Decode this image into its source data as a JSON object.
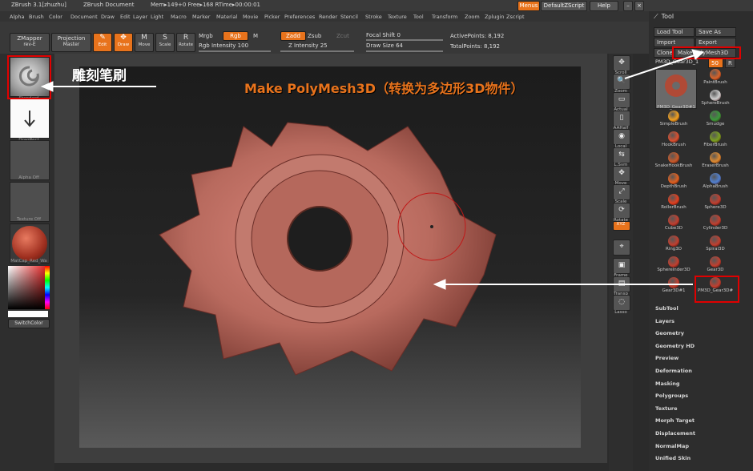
{
  "titlebar": {
    "app": "ZBrush  3.1[zhuzhu]",
    "document": "ZBrush Document",
    "stats": "Mem▸149+0  Free▸168  RTime▸00:00:01",
    "menus_btn": "Menus",
    "script_btn": "DefaultZScript",
    "help_btn": "Help"
  },
  "menubar": {
    "items": [
      "Alpha",
      "Brush",
      "Color",
      "Document",
      "Draw",
      "Edit",
      "Layer",
      "Light",
      "Macro",
      "Marker",
      "Material",
      "Movie",
      "Picker",
      "Preferences",
      "Render",
      "Stencil",
      "Stroke",
      "Texture",
      "Tool",
      "Transform",
      "Zoom",
      "Zplugin",
      "Zscript"
    ]
  },
  "toolbar": {
    "zmapper": "ZMapper",
    "zmapper_sub": "rev-E",
    "projection": "Projection",
    "projection_sub": "Master",
    "edit": "Edit",
    "draw": "Draw",
    "move": "Move",
    "scale": "Scale",
    "rotate": "Rotate",
    "mrgb": "Mrgb",
    "rgb": "Rgb",
    "m": "M",
    "rgb_intensity": "Rgb Intensity 100",
    "zadd": "Zadd",
    "zsub": "Zsub",
    "zcut": "Zcut",
    "z_intensity": "Z Intensity 25",
    "focal_shift": "Focal Shift 0",
    "draw_size": "Draw Size 64",
    "active_points": "ActivePoints: 8,192",
    "total_points": "TotalPoints: 8,192"
  },
  "leftshelf": {
    "brush_label": "Standard",
    "stroke_label": "DragRect",
    "alpha_label": "Alpha  Off",
    "texture_label": "Texture  Off",
    "material_label": "MatCap_Red_Wa",
    "switch_color": "SwitchColor"
  },
  "rightshelf": {
    "items": [
      "Scroll",
      "Zoom",
      "Actual",
      "AAHalf",
      "Local",
      "L.Sym",
      "Move",
      "Scale",
      "Rotate",
      "XYZ",
      "",
      "Frame",
      "Transp",
      "Lasso"
    ]
  },
  "toolpanel": {
    "title": "Tool",
    "load_tool": "Load Tool",
    "save_as": "Save As",
    "import": "Import",
    "export": "Export",
    "clone": "Clone",
    "make_polymesh": "Make PolyMesh3D",
    "current_tool": "PM3D_Gear3D_1",
    "count": "50",
    "r": "R",
    "current_thumb_label": "PM3D_Gear3D#1",
    "tools": [
      {
        "label": "PaintBrush",
        "color": "#d8632a"
      },
      {
        "label": "SphereBrush",
        "color": "#cfcfcf"
      },
      {
        "label": "SimpleBrush",
        "color": "#f0a020"
      },
      {
        "label": "Smudge",
        "color": "#3a9a3a"
      },
      {
        "label": "HookBrush",
        "color": "#d85030"
      },
      {
        "label": "FiberBrush",
        "color": "#7aa020"
      },
      {
        "label": "SnakeHookBrush",
        "color": "#c85a2a"
      },
      {
        "label": "EraserBrush",
        "color": "#dd8a30"
      },
      {
        "label": "DepthBrush",
        "color": "#e06020"
      },
      {
        "label": "AlphaBrush",
        "color": "#5080d0"
      },
      {
        "label": "RollerBrush",
        "color": "#e04020"
      },
      {
        "label": "Sphere3D",
        "color": "#c04030"
      },
      {
        "label": "Cube3D",
        "color": "#c04030"
      },
      {
        "label": "Cylinder3D",
        "color": "#c04030"
      },
      {
        "label": "Ring3D",
        "color": "#c04030"
      },
      {
        "label": "Spiral3D",
        "color": "#c04030"
      },
      {
        "label": "Sphereinder3D",
        "color": "#c04030"
      },
      {
        "label": "Gear3D",
        "color": "#c04030"
      },
      {
        "label": "Gear3D#1",
        "color": "#c04030"
      },
      {
        "label": "PM3D_Gear3D#",
        "color": "#c04030"
      }
    ],
    "submenus": [
      "SubTool",
      "Layers",
      "Geometry",
      "Geometry HD",
      "Preview",
      "Deformation",
      "Masking",
      "Polygroups",
      "Texture",
      "Morph Target",
      "Displacement",
      "NormalMap",
      "Unified Skin"
    ]
  },
  "annotations": {
    "sculpt_brush": "雕刻笔刷",
    "make_polymesh": "Make PolyMesh3D（转换为多边形3D物件）"
  },
  "colors": {
    "accent": "#e8731c",
    "annotation_red": "#e00000",
    "gear": "#b86a5e"
  }
}
